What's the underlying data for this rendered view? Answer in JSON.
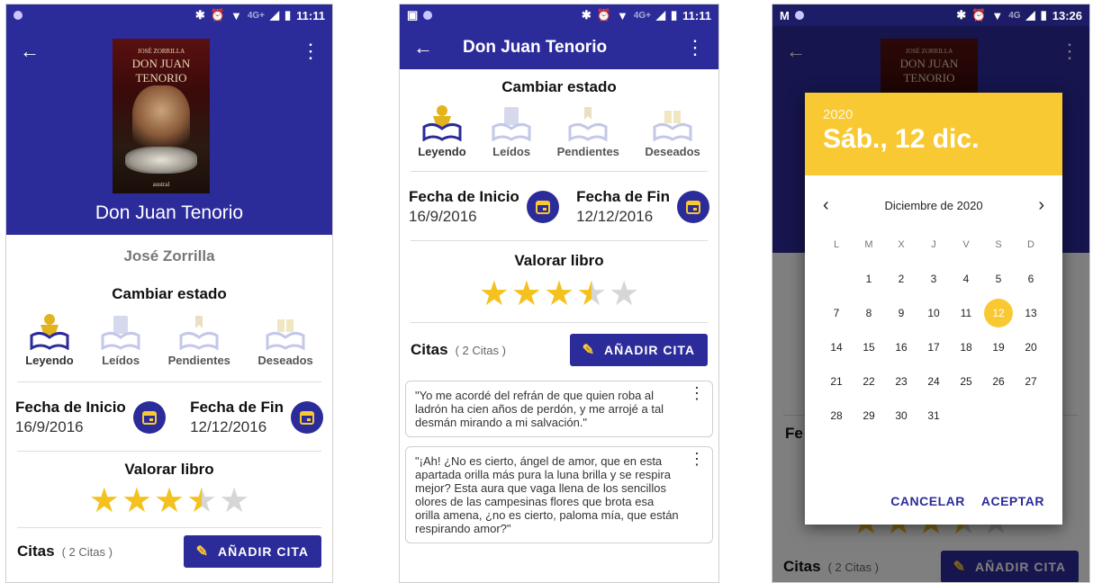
{
  "status": {
    "time1": "11:11",
    "time2": "11:11",
    "time3": "13:26",
    "net": "4G+",
    "net3": "4G"
  },
  "book": {
    "title": "Don Juan Tenorio",
    "author": "José Zorrilla",
    "cover_line1": "JOSÉ ZORRILLA",
    "cover_line2": "DON JUAN",
    "cover_line3": "TENORIO",
    "cover_publisher": "austral"
  },
  "estado": {
    "title": "Cambiar estado",
    "items": [
      "Leyendo",
      "Leídos",
      "Pendientes",
      "Deseados"
    ]
  },
  "dates": {
    "start_label": "Fecha de Inicio",
    "start_value": "16/9/2016",
    "end_label": "Fecha de Fin",
    "end_value": "12/12/2016"
  },
  "rating": {
    "title": "Valorar libro",
    "value": 3.5,
    "max": 5
  },
  "citas": {
    "label": "Citas",
    "count": "( 2 Citas )",
    "add_button": "AÑADIR CITA"
  },
  "quotes": [
    "\"Yo me acordé del refrán de que quien roba al ladrón ha cien años de perdón, y me arrojé a tal desmán mirando a mi salvación.\"",
    "\"¡Ah! ¿No es cierto, ángel de amor, que en esta apartada orilla más pura la luna brilla y se respira mejor? Esta aura que vaga llena de los sencillos olores de las campesinas flores que brota esa orilla amena, ¿no es cierto, paloma mía, que están respirando amor?\""
  ],
  "datepicker": {
    "year": "2020",
    "date": "Sáb., 12 dic.",
    "month": "Diciembre de 2020",
    "weekdays": [
      "L",
      "M",
      "X",
      "J",
      "V",
      "S",
      "D"
    ],
    "days": [
      "",
      "1",
      "2",
      "3",
      "4",
      "5",
      "6",
      "7",
      "8",
      "9",
      "10",
      "11",
      "12",
      "13",
      "14",
      "15",
      "16",
      "17",
      "18",
      "19",
      "20",
      "21",
      "22",
      "23",
      "24",
      "25",
      "26",
      "27",
      "28",
      "29",
      "30",
      "31"
    ],
    "selected": "12",
    "cancel": "CANCELAR",
    "accept": "ACEPTAR"
  },
  "colors": {
    "primary": "#2c2b9a",
    "accent": "#f9c933",
    "star": "#f4c21f"
  },
  "icons": [
    "back-arrow-icon",
    "more-vert-icon",
    "calendar-icon",
    "pencil-icon",
    "bluetooth-icon",
    "alarm-icon",
    "wifi-icon",
    "signal-icon",
    "battery-icon",
    "chevron-left-icon",
    "chevron-right-icon"
  ]
}
